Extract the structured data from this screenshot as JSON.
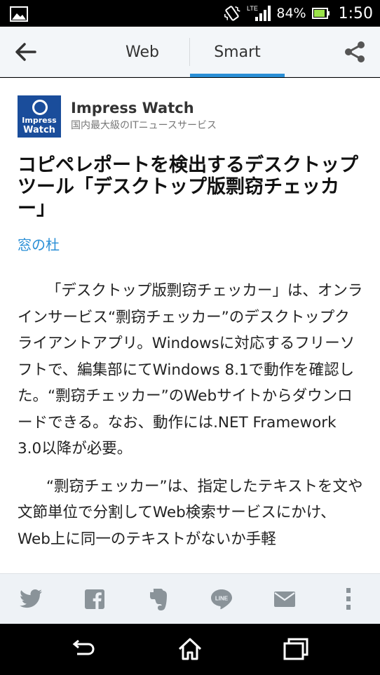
{
  "status_bar": {
    "network": "LTE",
    "battery": "84%",
    "time": "1:50"
  },
  "app_bar": {
    "tabs": [
      {
        "label": "Web"
      },
      {
        "label": "Smart"
      }
    ]
  },
  "source": {
    "logo_line1": "Impress",
    "logo_line2": "Watch",
    "name": "Impress Watch",
    "description": "国内最大級のITニュースサービス"
  },
  "article": {
    "title": "コピペレポートを検出するデスクトップツール「デスクトップ版剽窃チェッカー」",
    "category": "窓の杜",
    "paragraphs": [
      "「デスクトップ版剽窃チェッカー」は、オンラインサービス“剽窃チェッカー”のデスクトップクライアントアプリ。Windowsに対応するフリーソフトで、編集部にてWindows 8.1で動作を確認した。“剽窃チェッカー”のWebサイトからダウンロードできる。なお、動作には.NET Framework 3.0以降が必要。",
      "“剽窃チェッカー”は、指定したテキストを文や文節単位で分割してWeb検索サービスにかけ、Web上に同一のテキストがないか手軽"
    ]
  },
  "colors": {
    "accent": "#2a8fd6",
    "app_bar_bg": "#f3f6f9",
    "share_bar_bg": "#eef2f6",
    "icon_gray": "#8a9399"
  },
  "icons": {
    "share_bar": [
      "twitter-icon",
      "facebook-icon",
      "evernote-icon",
      "line-icon",
      "mail-icon",
      "overflow-icon"
    ],
    "nav_bar": [
      "back-icon",
      "home-icon",
      "recents-icon"
    ]
  }
}
